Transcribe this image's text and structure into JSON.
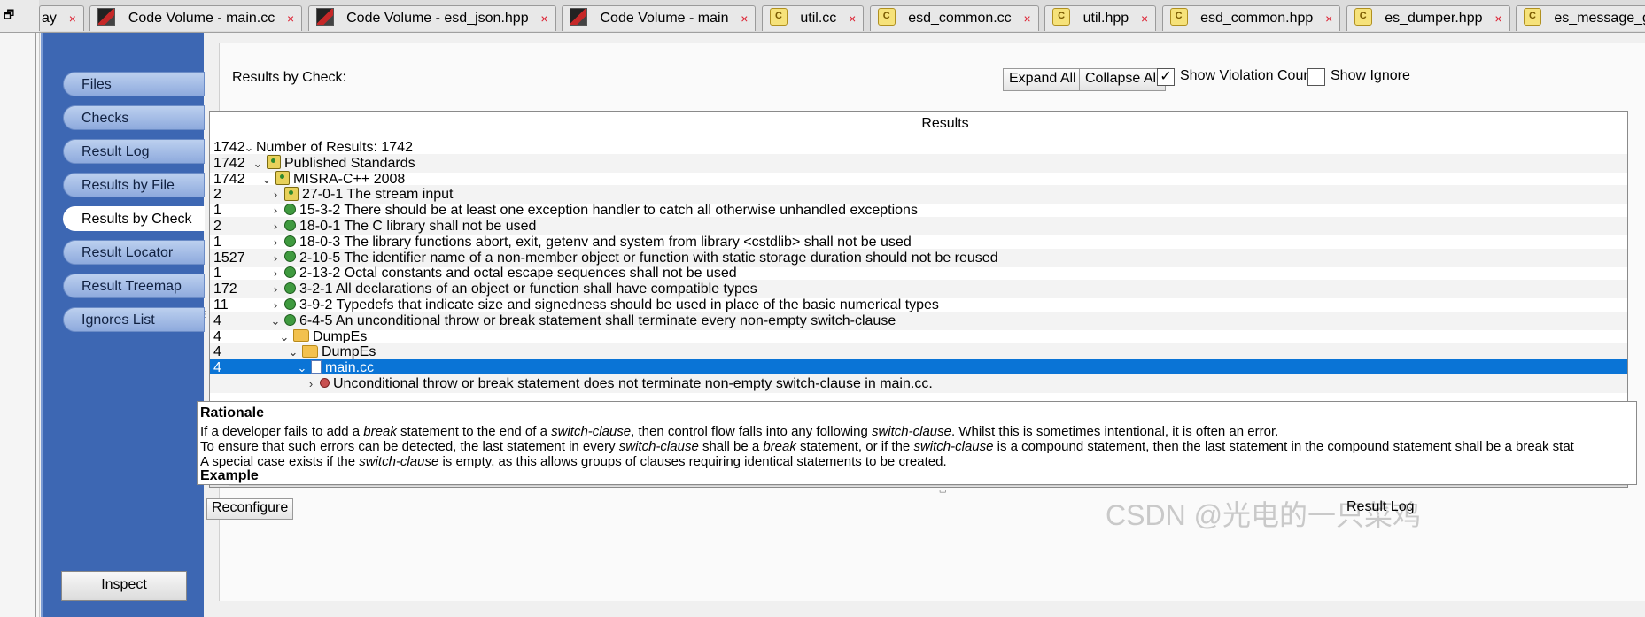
{
  "tabs": [
    {
      "label": "ay",
      "icon": "none"
    },
    {
      "label": "Code Volume - main.cc",
      "icon": "code-volume-icon"
    },
    {
      "label": "Code Volume - esd_json.hpp",
      "icon": "code-volume-icon"
    },
    {
      "label": "Code Volume - main",
      "icon": "code-volume-icon"
    },
    {
      "label": "util.cc",
      "icon": "source-file-icon"
    },
    {
      "label": "esd_common.cc",
      "icon": "source-file-icon"
    },
    {
      "label": "util.hpp",
      "icon": "source-file-icon"
    },
    {
      "label": "esd_common.hpp",
      "icon": "source-file-icon"
    },
    {
      "label": "es_dumper.hpp",
      "icon": "source-file-icon"
    },
    {
      "label": "es_message_generated.h",
      "icon": "source-file-icon"
    }
  ],
  "tab_close_glyph": "×",
  "sidebar": {
    "items": [
      "Files",
      "Checks",
      "Result Log",
      "Results by File",
      "Results by Check",
      "Result Locator",
      "Result Treemap",
      "Ignores List"
    ],
    "active": "Results by Check",
    "inspect_label": "Inspect"
  },
  "header": {
    "title": "Results by Check:",
    "expand_all": "Expand All",
    "collapse_all": "Collapse All",
    "show_violation_counts": "Show Violation Counts",
    "show_violation_counts_checked": true,
    "show_ignored": "Show Ignore"
  },
  "results": {
    "column_header": "Results",
    "rows": [
      {
        "count": "1742",
        "expander": "v",
        "icon": "none",
        "text": "Number of Results: 1742"
      },
      {
        "count": "1742",
        "expander": "v",
        "icon": "standard",
        "text": "Published Standards"
      },
      {
        "count": "1742",
        "expander": "v",
        "icon": "standard",
        "text": "MISRA-C++ 2008"
      },
      {
        "count": "2",
        "expander": ">",
        "icon": "standard",
        "text": "27-0-1 The stream input"
      },
      {
        "count": "1",
        "expander": ">",
        "icon": "check",
        "text": "15-3-2 There should be at least one exception handler to catch all otherwise unhandled exceptions"
      },
      {
        "count": "2",
        "expander": ">",
        "icon": "check",
        "text": "18-0-1 The C library shall not be used"
      },
      {
        "count": "1",
        "expander": ">",
        "icon": "check",
        "text": "18-0-3 The library functions abort, exit, getenv and system from library <cstdlib> shall not be used"
      },
      {
        "count": "1527",
        "expander": ">",
        "icon": "check",
        "text": "2-10-5 The identifier name of a non-member object or function with static storage duration should not be reused"
      },
      {
        "count": "1",
        "expander": ">",
        "icon": "check",
        "text": "2-13-2 Octal constants and octal escape sequences shall not be used"
      },
      {
        "count": "172",
        "expander": ">",
        "icon": "check",
        "text": "3-2-1 All declarations of an object or function shall have compatible types"
      },
      {
        "count": "11",
        "expander": ">",
        "icon": "check",
        "text": "3-9-2 Typedefs that indicate size and signedness should be used in place of the basic numerical types"
      },
      {
        "count": "4",
        "expander": "v",
        "icon": "check",
        "text": "6-4-5 An unconditional throw or break statement shall terminate every non-empty switch-clause"
      },
      {
        "count": "4",
        "expander": "v",
        "icon": "folder",
        "text": "DumpEs"
      },
      {
        "count": "4",
        "expander": "v",
        "icon": "folder",
        "text": "DumpEs"
      },
      {
        "count": "4",
        "expander": "v",
        "icon": "file",
        "text": "main.cc",
        "selected": true
      },
      {
        "count": "",
        "expander": ">",
        "icon": "violation",
        "text": "Unconditional throw or break statement does not terminate non-empty switch-clause in main.cc."
      }
    ],
    "scroll_left_glyph": "<"
  },
  "rationale": {
    "heading": "Rationale",
    "line1": [
      "If a developer fails to add a ",
      "break",
      " statement to the end of a ",
      "switch-clause",
      ", then control flow falls into any following ",
      "switch-clause",
      ". Whilst this is sometimes intentional, it is often an error."
    ],
    "line2": [
      "To ensure that such errors can be detected, the last statement in every ",
      "switch-clause",
      " shall be a ",
      "break",
      " statement, or if the ",
      "switch-clause",
      " is a compound statement, then the last statement in the compound statement shall be a break stat"
    ],
    "line3": [
      "A special case exists if the ",
      "switch-clause",
      " is empty, as this allows groups of clauses requiring identical statements to be created."
    ],
    "example_heading": "Example"
  },
  "footer": {
    "reconfigure": "Reconfigure",
    "result_log": "Result Log"
  },
  "watermark": "CSDN @光电的一只菜鸡"
}
